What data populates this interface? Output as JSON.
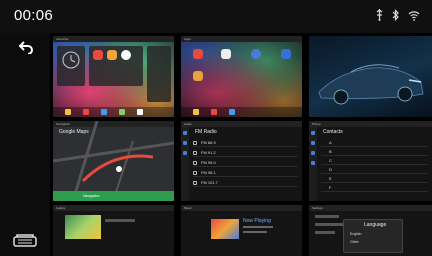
{
  "status": {
    "time": "00:06",
    "icons": [
      "usb-icon",
      "bluetooth-icon",
      "wifi-icon"
    ]
  },
  "nav": {
    "icons": [
      "back-icon",
      "home-icon"
    ]
  },
  "tiles": {
    "t1": {
      "bar": "Launcher"
    },
    "t2": {
      "bar": "Apps"
    },
    "t4": {
      "bar": "Navigation",
      "map_title": "Google Maps",
      "map_sub": "Navigation"
    },
    "t5": {
      "bar": "Audio",
      "title": "FM Radio",
      "rows": [
        "FM 88.9",
        "FM 91.2",
        "FM 95.0",
        "FM 98.1",
        "FM 101.7"
      ]
    },
    "t6": {
      "bar": "Phone",
      "title": "Contacts",
      "rows": [
        "A",
        "B",
        "C",
        "D",
        "E",
        "F"
      ]
    },
    "t7": {
      "bar": "Gallery"
    },
    "t8": {
      "bar": "Music",
      "title": "Now Playing"
    },
    "t9": {
      "bar": "Settings",
      "dialog_title": "Language",
      "opt1": "English",
      "opt2": "Other"
    }
  },
  "colors": {
    "accent": "#4a7bd8",
    "route": "#e94a3c",
    "statusbar": "#101010"
  }
}
